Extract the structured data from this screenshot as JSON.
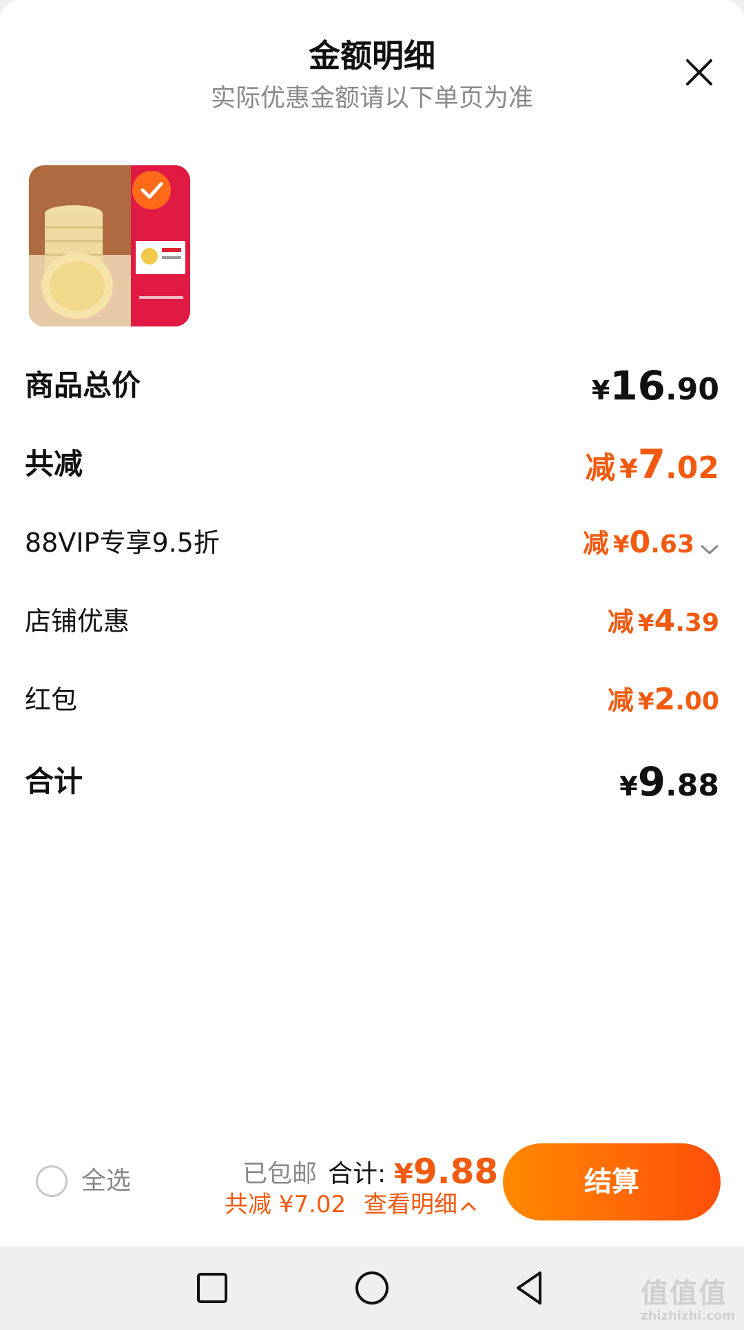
{
  "header": {
    "title": "金额明细",
    "subtitle": "实际优惠金额请以下单页为准"
  },
  "product": {
    "image_icon": "product-thumbnail-image",
    "selected_icon": "check-icon"
  },
  "rows": {
    "goods_total": {
      "label": "商品总价",
      "currency": "¥",
      "int": "16",
      "dec": ".90"
    },
    "total_discount": {
      "label": "共减",
      "prefix": "减",
      "currency": "¥",
      "int": "7",
      "dec": ".02"
    },
    "vip": {
      "label": "88VIP专享9.5折",
      "prefix": "减",
      "currency": "¥",
      "int": "0",
      "dec": ".63"
    },
    "store": {
      "label": "店铺优惠",
      "prefix": "减",
      "currency": "¥",
      "int": "4",
      "dec": ".39"
    },
    "redpacket": {
      "label": "红包",
      "prefix": "减",
      "currency": "¥",
      "int": "2",
      "dec": ".00"
    },
    "sum": {
      "label": "合计",
      "currency": "¥",
      "int": "9",
      "dec": ".88"
    }
  },
  "bottom_bar": {
    "select_all": "全选",
    "shipping": "已包邮",
    "total_label": "合计:",
    "total_currency": "¥",
    "total_value": "9.88",
    "saved": "共减 ¥7.02",
    "view_detail": "查看明细",
    "checkout": "结算"
  },
  "watermark": {
    "logo": "值值值",
    "url": "zhizhizhi.com"
  },
  "colors": {
    "accent": "#f15a0f",
    "checkout_start": "#ff8a00",
    "checkout_end": "#ff4f0a"
  }
}
